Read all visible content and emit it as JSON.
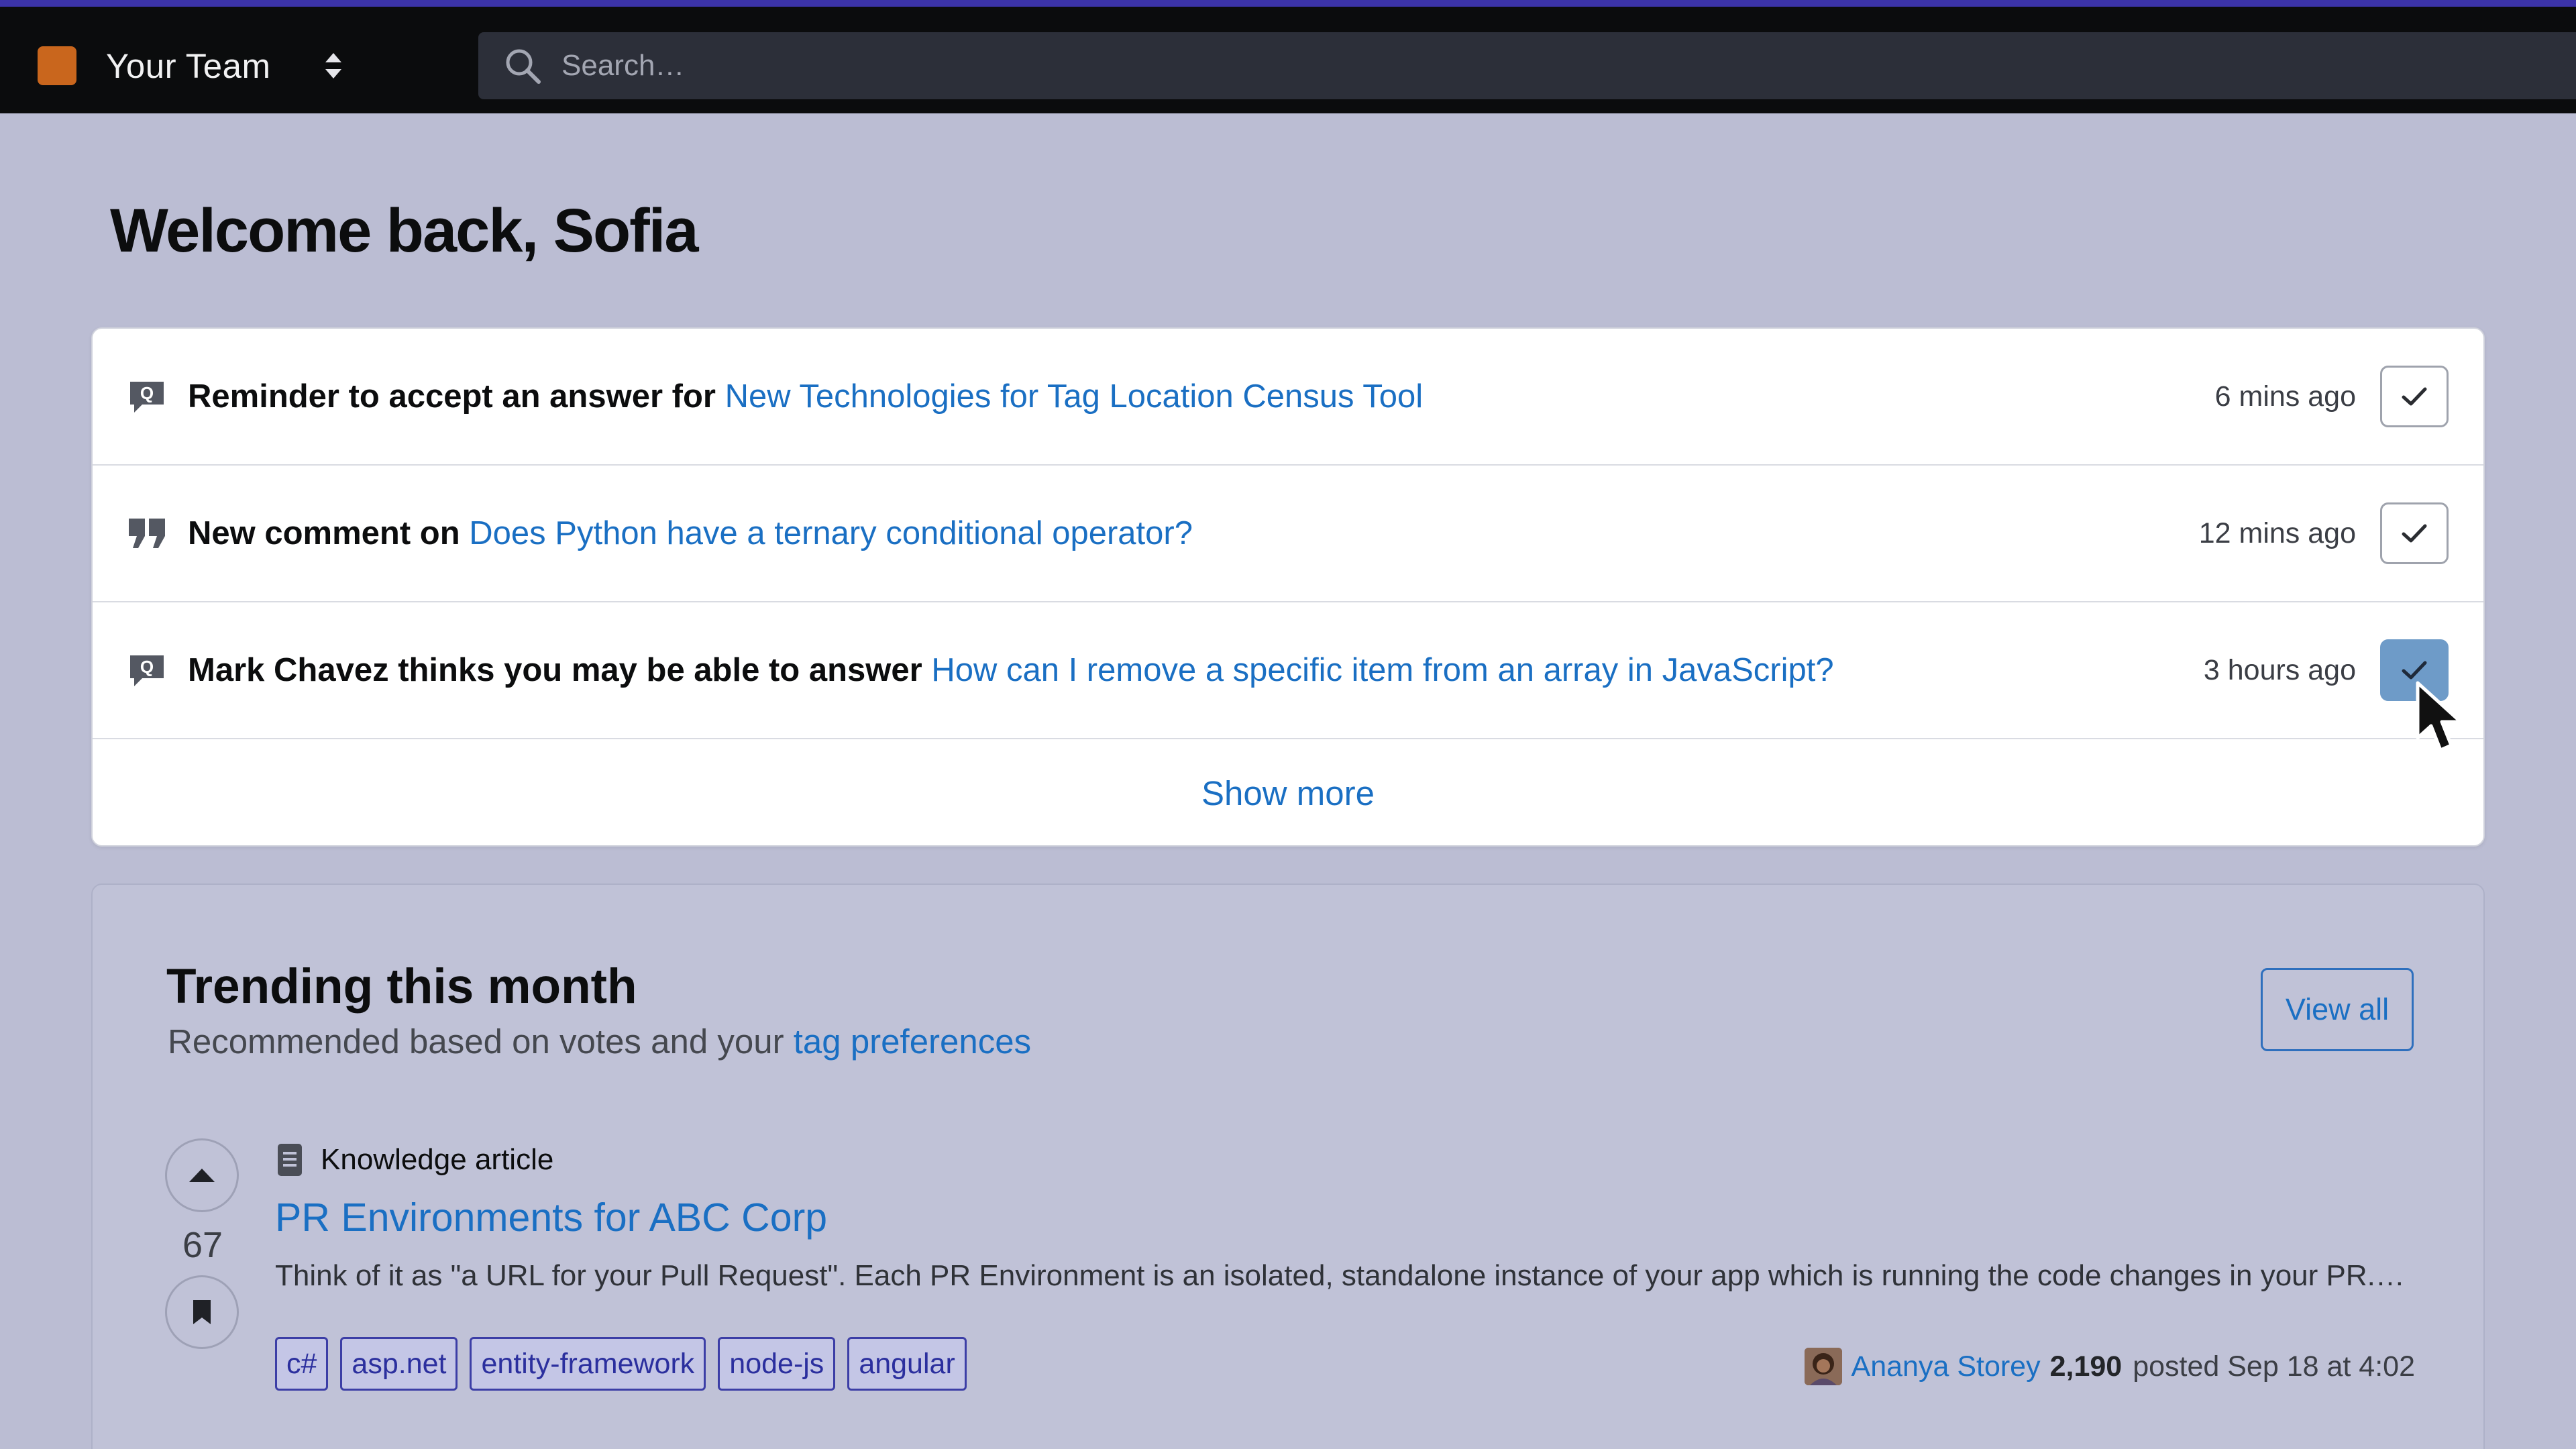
{
  "topbar": {
    "team_name": "Your Team",
    "search_placeholder": "Search…",
    "accent_color": "#3b33a8",
    "team_logo_color": "#c9661d"
  },
  "welcome": {
    "title": "Welcome back, Sofia"
  },
  "notifications": {
    "items": [
      {
        "icon": "question-icon",
        "prefix": "Reminder to accept an answer for",
        "link": "New Technologies for Tag Location Census Tool",
        "time": "6 mins ago",
        "checked": false
      },
      {
        "icon": "comment-icon",
        "prefix": "New comment on",
        "link": "Does Python have a ternary conditional operator?",
        "time": "12 mins ago",
        "checked": false
      },
      {
        "icon": "question-icon",
        "prefix": "Mark Chavez thinks you may be able to answer",
        "link": "How can I remove a specific item from an array in JavaScript?",
        "time": "3 hours ago",
        "checked": true
      }
    ],
    "show_more": "Show more"
  },
  "trending": {
    "title": "Trending this month",
    "subtitle": "Recommended based on votes and your",
    "subtitle_link": "tag preferences",
    "view_all": "View all",
    "post": {
      "type_label": "Knowledge article",
      "title": "PR Environments for ABC Corp",
      "excerpt": "Think of it as \"a URL for your Pull Request\". Each PR Environment is an isolated, standalone instance of your app which is running the code changes in your PR.…",
      "votes": "67",
      "tags": [
        "c#",
        "asp.net",
        "entity-framework",
        "node-js",
        "angular"
      ],
      "author": "Ananya Storey",
      "reputation": "2,190",
      "posted": "posted Sep 18 at 4:02"
    }
  }
}
